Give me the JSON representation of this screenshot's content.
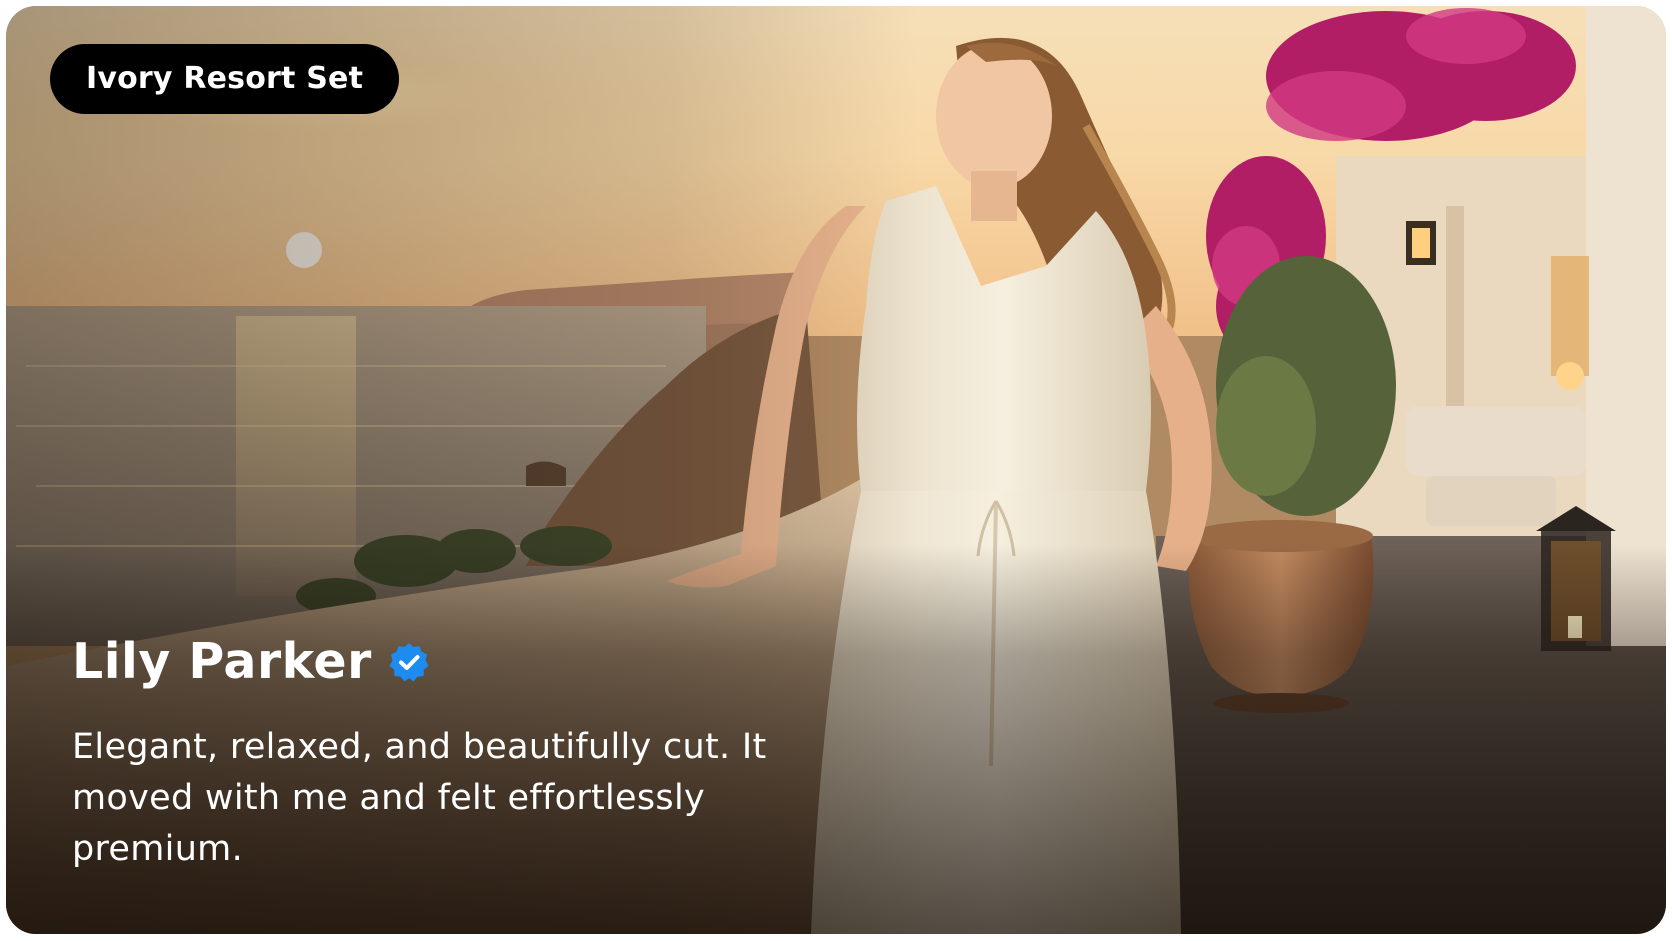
{
  "badge": {
    "label": "Ivory Resort Set"
  },
  "reviewer": {
    "name": "Lily Parker",
    "verified_icon": "verified-badge-icon",
    "verified_color": "#1E8BF0"
  },
  "review": {
    "text": "Elegant, relaxed, and beautifully cut. It moved with me and felt effortlessly premium."
  },
  "colors": {
    "badge_background": "#000000",
    "text": "#FFFFFF"
  }
}
